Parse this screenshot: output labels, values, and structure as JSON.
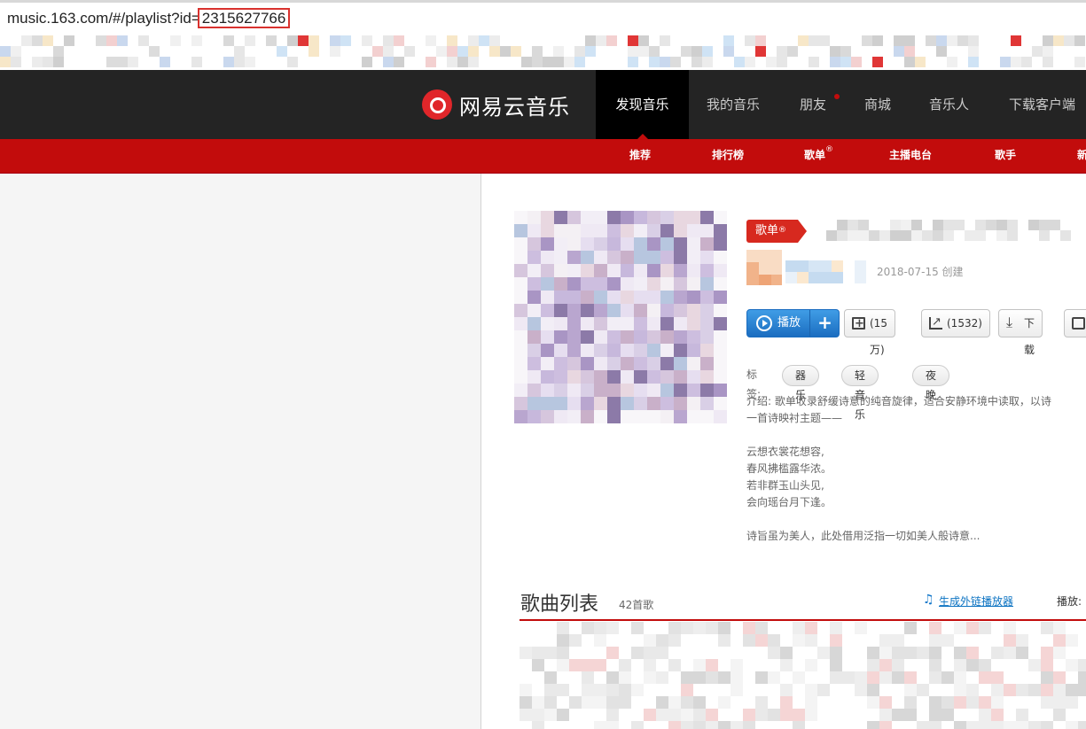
{
  "browser": {
    "url_prefix": "music.163.com/#/playlist?id=",
    "url_id": "2315627766"
  },
  "header": {
    "logo_text": "网易云音乐",
    "nav": [
      {
        "label": "发现音乐",
        "active": true
      },
      {
        "label": "我的音乐"
      },
      {
        "label": "朋友"
      },
      {
        "label": "商城"
      },
      {
        "label": "音乐人"
      },
      {
        "label": "下载客户端"
      }
    ],
    "subnav": [
      {
        "label": "推荐"
      },
      {
        "label": "排行榜"
      },
      {
        "label": "歌单",
        "sup": "®"
      },
      {
        "label": "主播电台"
      },
      {
        "label": "歌手"
      },
      {
        "label": "新"
      }
    ]
  },
  "playlist": {
    "badge": "歌单",
    "badge_sup": "®",
    "created": "2018-07-15 创建",
    "play_label": "播放",
    "add_label": "+",
    "fav_label": "(15万)",
    "share_label": "(1532)",
    "download_label": "下载",
    "tags_label": "标签:",
    "tags": [
      "器乐",
      "轻音乐",
      "夜晚"
    ],
    "intro_lines": [
      "介绍:  歌单收录舒缓诗意的纯音旋律，适合安静环境中读取，以诗",
      "一首诗映衬主题——",
      "",
      "云想衣裳花想容,",
      "春风拂槛露华浓。",
      "若非群玉山头见,",
      "会向瑶台月下逢。",
      "",
      "诗旨虽为美人，此处借用泛指一切如美人般诗意..."
    ]
  },
  "songlist": {
    "title": "歌曲列表",
    "count": "42首歌",
    "outlink": "生成外链播放器",
    "play_prefix": "播放:"
  },
  "colors": {
    "brand_red": "#c20c0c",
    "nav_dark": "#242424",
    "play_blue": "#1b6dc0",
    "link_blue": "#0c73c2"
  }
}
